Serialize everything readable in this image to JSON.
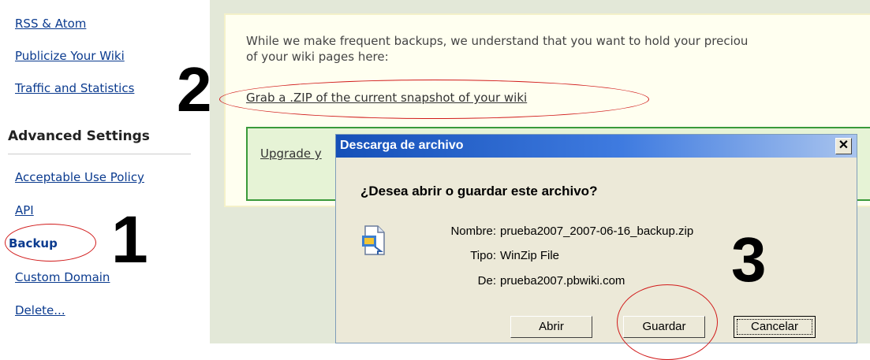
{
  "sidebar": {
    "links_top": [
      {
        "label": "RSS & Atom"
      },
      {
        "label": "Publicize Your Wiki"
      },
      {
        "label": "Traffic and Statistics"
      }
    ],
    "section_heading": "Advanced Settings",
    "links_advanced": [
      {
        "label": "Acceptable Use Policy"
      },
      {
        "label": "API"
      },
      {
        "label": "Backup"
      },
      {
        "label": "Custom Domain"
      },
      {
        "label": "Delete..."
      }
    ]
  },
  "main": {
    "intro_line1": "While we make frequent backups, we understand that you want to hold your preciou",
    "intro_line2": "of your wiki pages here:",
    "zip_link": "Grab a .ZIP of the current snapshot of your wiki",
    "upgrade_link": "Upgrade y"
  },
  "annotations": {
    "step1": "1",
    "step2": "2",
    "step3": "3",
    "highlight_color": "#d11a1a"
  },
  "dialog": {
    "title": "Descarga de archivo",
    "close": "✕",
    "question": "¿Desea abrir o guardar este archivo?",
    "fields": [
      {
        "label": "Nombre:",
        "value": "prueba2007_2007-06-16_backup.zip"
      },
      {
        "label": "Tipo:",
        "value": "WinZip File"
      },
      {
        "label": "De:",
        "value": "prueba2007.pbwiki.com"
      }
    ],
    "buttons": {
      "open": "Abrir",
      "save": "Guardar",
      "cancel": "Cancelar"
    },
    "icon": "zip-file-icon"
  }
}
